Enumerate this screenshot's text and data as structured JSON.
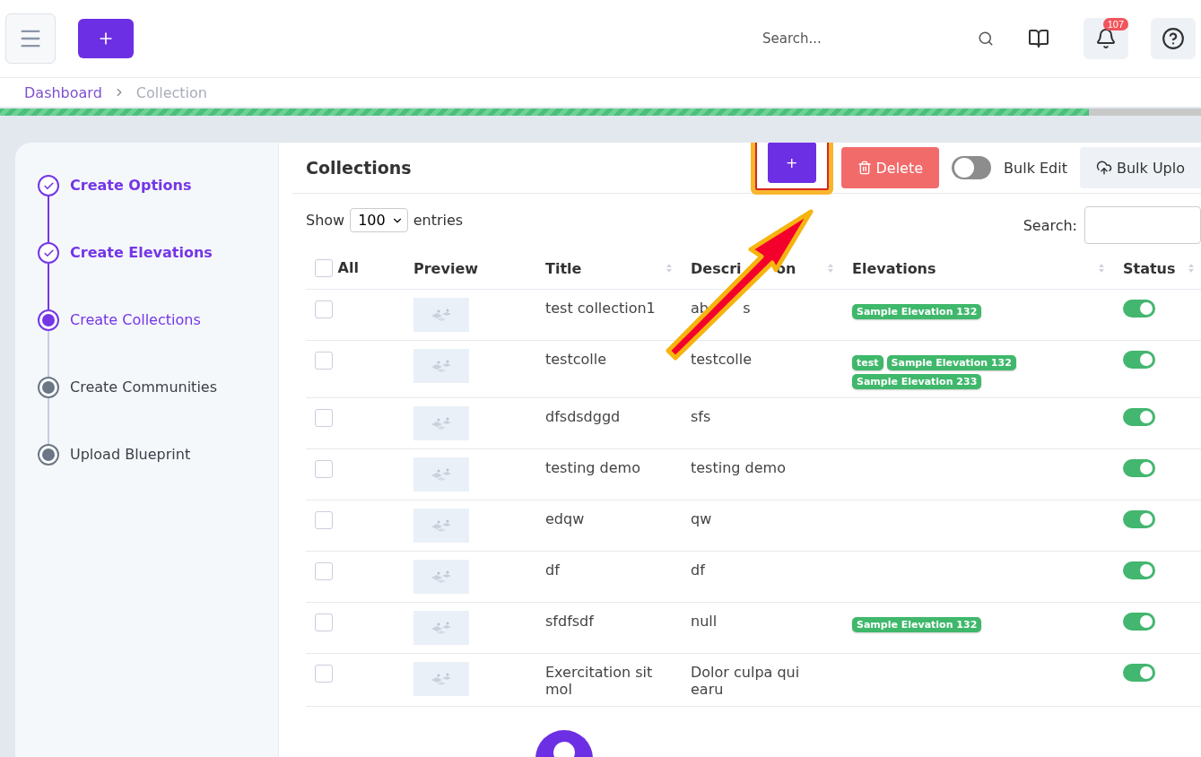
{
  "header": {
    "search": {
      "placeholder": "Search..."
    },
    "notifications": {
      "count": "107"
    }
  },
  "breadcrumb": [
    {
      "label": "Dashboard",
      "selected": false
    },
    {
      "label": "Collection",
      "selected": true
    }
  ],
  "progress": {
    "level": 0.907
  },
  "steps": [
    {
      "label": "Create Options",
      "completed": true,
      "selected": false
    },
    {
      "label": "Create Elevations",
      "completed": true,
      "selected": false
    },
    {
      "label": "Create Collections",
      "completed": false,
      "selected": true
    },
    {
      "label": "Create Communities",
      "completed": false,
      "selected": false
    },
    {
      "label": "Upload Blueprint",
      "completed": false,
      "selected": false
    }
  ],
  "panel": {
    "title": "Collections",
    "add_button": "+",
    "delete_button": "Delete",
    "bulk_edit": {
      "label": "Bulk Edit",
      "on": false
    },
    "bulk_upload": "Bulk Uplo"
  },
  "length": {
    "before": "Show",
    "value": "100",
    "after": "entries"
  },
  "filter": {
    "label": "Search:"
  },
  "table": {
    "all_selected": false,
    "columns": [
      {
        "label": "All",
        "kind": "check"
      },
      {
        "label": "Preview",
        "kind": "plain"
      },
      {
        "label": "Title",
        "kind": "sort"
      },
      {
        "label": "Descri",
        "label_tail": "on",
        "kind": "sort"
      },
      {
        "label": "Elevations",
        "kind": "sort"
      },
      {
        "label": "Status",
        "kind": "sort"
      }
    ],
    "rows": [
      {
        "selected": false,
        "title": "test collection1",
        "description": "ab",
        "description_tail": "s",
        "elevations": [
          "Sample Elevation 132"
        ],
        "on": true
      },
      {
        "selected": false,
        "title": "testcolle",
        "description": "testcolle",
        "elevations": [
          "test",
          "Sample Elevation 132",
          "Sample Elevation 233"
        ],
        "on": true
      },
      {
        "selected": false,
        "title": "dfsdsdggd",
        "description": "sfs",
        "elevations": [],
        "on": true
      },
      {
        "selected": false,
        "title": "testing demo",
        "description": "testing demo",
        "elevations": [],
        "on": true
      },
      {
        "selected": false,
        "title": "edqw",
        "description": "qw",
        "elevations": [],
        "on": true
      },
      {
        "selected": false,
        "title": "df",
        "description": "df",
        "elevations": [],
        "on": true
      },
      {
        "selected": false,
        "title": "sfdfsdf",
        "description": "null",
        "elevations": [
          "Sample Elevation 132"
        ],
        "on": true
      },
      {
        "selected": false,
        "title": "Exercitation sit mol",
        "description": "Dolor culpa qui earu",
        "elevations": [],
        "on": true
      }
    ]
  }
}
